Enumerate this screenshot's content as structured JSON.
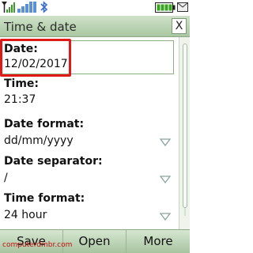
{
  "window": {
    "title": "Time & date",
    "close_label": "X"
  },
  "fields": [
    {
      "label": "Date:",
      "value": "12/02/2017"
    },
    {
      "label": "Time:",
      "value": "21:37"
    },
    {
      "label": "Date format:",
      "value": "dd/mm/yyyy"
    },
    {
      "label": "Date separator:",
      "value": "/"
    },
    {
      "label": "Time format:",
      "value": "24 hour"
    }
  ],
  "softkeys": {
    "left": "Save",
    "middle": "Open",
    "right": "More"
  },
  "watermark": "computerdmbr.com",
  "colors": {
    "titlebar": "#bcd6b5",
    "highlight": "#e01818"
  }
}
